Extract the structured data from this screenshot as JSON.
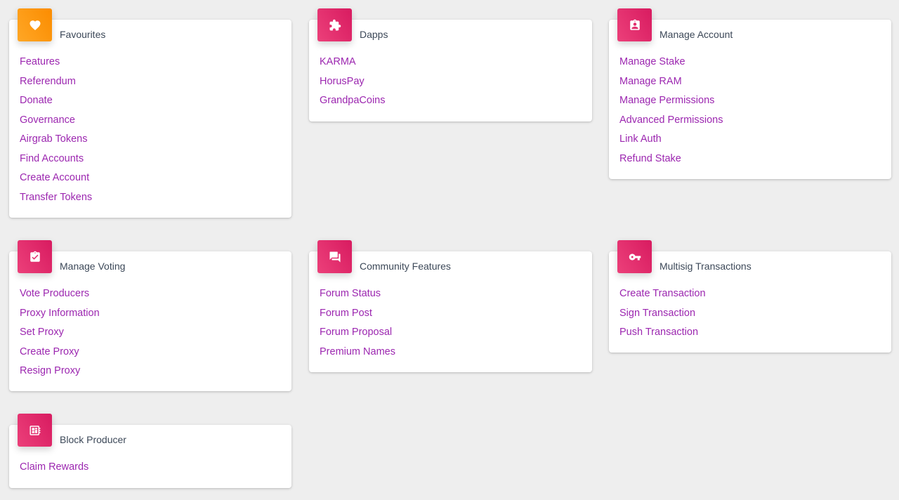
{
  "theme": {
    "background": "#eeeeee",
    "link_color": "#9c27b0",
    "title_color": "#3c4858",
    "icon_orange": "#fb8c00",
    "icon_pink": "#e91e63"
  },
  "cards": {
    "favourites": {
      "title": "Favourites",
      "icon": "heart-icon",
      "links": [
        "Features",
        "Referendum",
        "Donate",
        "Governance",
        "Airgrab Tokens",
        "Find Accounts",
        "Create Account",
        "Transfer Tokens"
      ]
    },
    "dapps": {
      "title": "Dapps",
      "icon": "puzzle-icon",
      "links": [
        "KARMA",
        "HorusPay",
        "GrandpaCoins"
      ]
    },
    "manage_account": {
      "title": "Manage Account",
      "icon": "account-box-icon",
      "links": [
        "Manage Stake",
        "Manage RAM",
        "Manage Permissions",
        "Advanced Permissions",
        "Link Auth",
        "Refund Stake"
      ]
    },
    "manage_voting": {
      "title": "Manage Voting",
      "icon": "clipboard-check-icon",
      "links": [
        "Vote Producers",
        "Proxy Information",
        "Set Proxy",
        "Create Proxy",
        "Resign Proxy"
      ]
    },
    "community_features": {
      "title": "Community Features",
      "icon": "forum-icon",
      "links": [
        "Forum Status",
        "Forum Post",
        "Forum Proposal",
        "Premium Names"
      ]
    },
    "multisig_transactions": {
      "title": "Multisig Transactions",
      "icon": "key-icon",
      "links": [
        "Create Transaction",
        "Sign Transaction",
        "Push Transaction"
      ]
    },
    "block_producer": {
      "title": "Block Producer",
      "icon": "developer-board-icon",
      "links": [
        "Claim Rewards"
      ]
    }
  }
}
